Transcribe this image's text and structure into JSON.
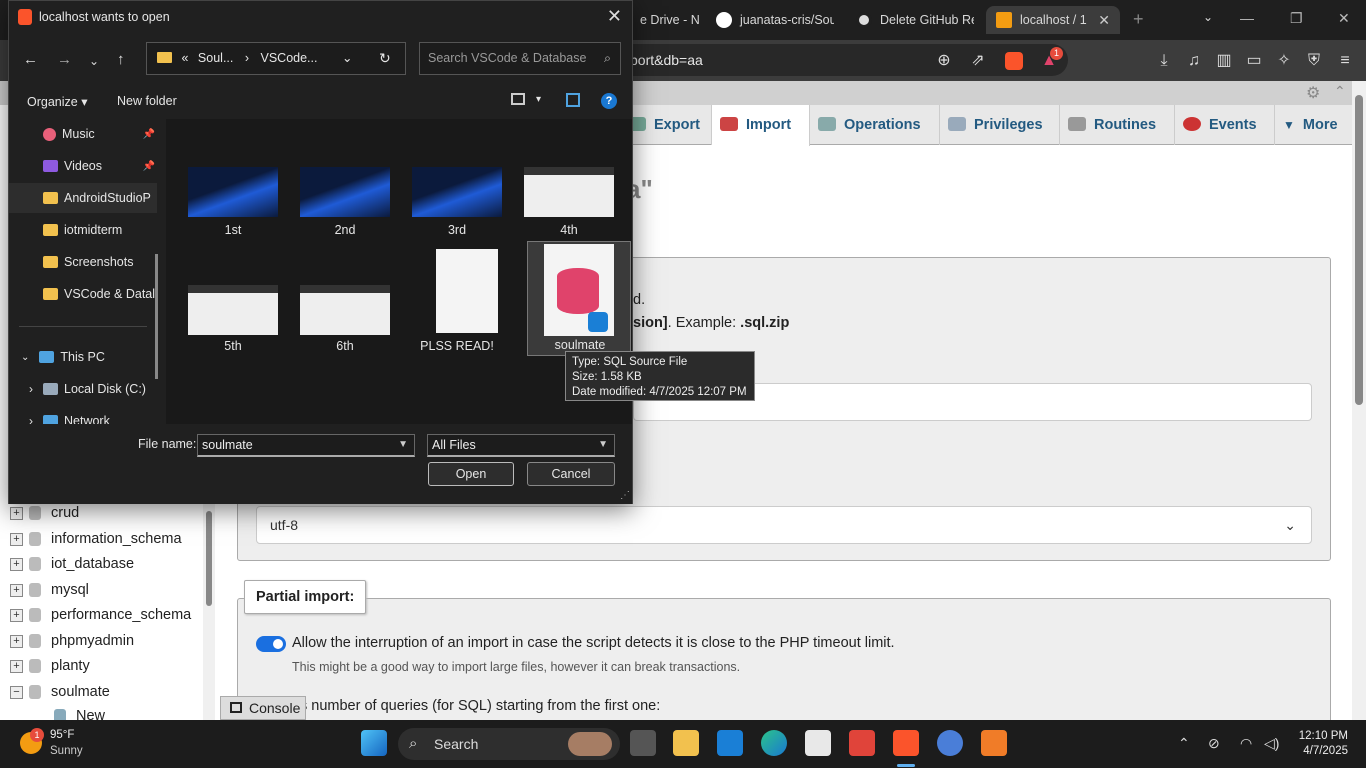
{
  "browser": {
    "tabs": [
      {
        "label": "e Drive - N"
      },
      {
        "label": "juanatas-cris/Sou"
      },
      {
        "label": "Delete GitHub Re"
      },
      {
        "label": "localhost / 1"
      }
    ],
    "address": "port&db=aa",
    "brave_badge": "1"
  },
  "pma": {
    "tabs": [
      "Export",
      "Import",
      "Operations",
      "Privileges",
      "Routines",
      "Events",
      "More"
    ],
    "heading_fragment": "a\"",
    "file_text_1": "d.",
    "file_text_2_bold": "sion]",
    "file_text_2_rest": ". Example: ",
    "file_text_2_ext": ".sql.zip",
    "charset": "utf-8",
    "partial_legend": "Partial import:",
    "allow_interrupt": "Allow the interruption of an import in case the script detects it is close to the PHP timeout limit.",
    "allow_hint": "This might be a good way to import large files, however it can break transactions.",
    "skip_text": "s number of queries (for SQL) starting from the first one:",
    "console": "Console",
    "nav_dbs": [
      "crud",
      "information_schema",
      "iot_database",
      "mysql",
      "performance_schema",
      "phpmyadmin",
      "planty",
      "soulmate"
    ],
    "nav_new": "New"
  },
  "dialog": {
    "title": "localhost wants to open",
    "path": [
      "Soul...",
      "VSCode..."
    ],
    "path_prefix": "«",
    "search_placeholder": "Search VSCode & Database",
    "organize": "Organize",
    "new_folder": "New folder",
    "nav_items": [
      {
        "label": "Music",
        "pinned": true,
        "icon": "music-icon"
      },
      {
        "label": "Videos",
        "pinned": true,
        "icon": "video-icon"
      },
      {
        "label": "AndroidStudioP",
        "pinned": false,
        "icon": "folder-icon"
      },
      {
        "label": "iotmidterm",
        "pinned": false,
        "icon": "folder-icon"
      },
      {
        "label": "Screenshots",
        "pinned": false,
        "icon": "folder-icon"
      },
      {
        "label": "VSCode & Datal",
        "pinned": false,
        "icon": "folder-icon"
      }
    ],
    "this_pc": "This PC",
    "local_disk": "Local Disk (C:)",
    "network": "Network",
    "files": [
      "1st",
      "2nd",
      "3rd",
      "4th",
      "5th",
      "6th",
      "PLSS READ!",
      "soulmate"
    ],
    "tooltip": {
      "type": "Type: SQL Source File",
      "size": "Size: 1.58 KB",
      "date": "Date modified: 4/7/2025 12:07 PM"
    },
    "file_name_label": "File name:",
    "file_name_value": "soulmate",
    "file_type": "All Files",
    "open": "Open",
    "cancel": "Cancel"
  },
  "taskbar": {
    "temp": "95°F",
    "condition": "Sunny",
    "weather_badge": "1",
    "search": "Search",
    "time": "12:10 PM",
    "date": "4/7/2025"
  },
  "colors": {
    "accent": "#235a81",
    "toggle": "#1a6fe0",
    "brave": "#fb542b",
    "sql_icon": "#e0436b"
  }
}
